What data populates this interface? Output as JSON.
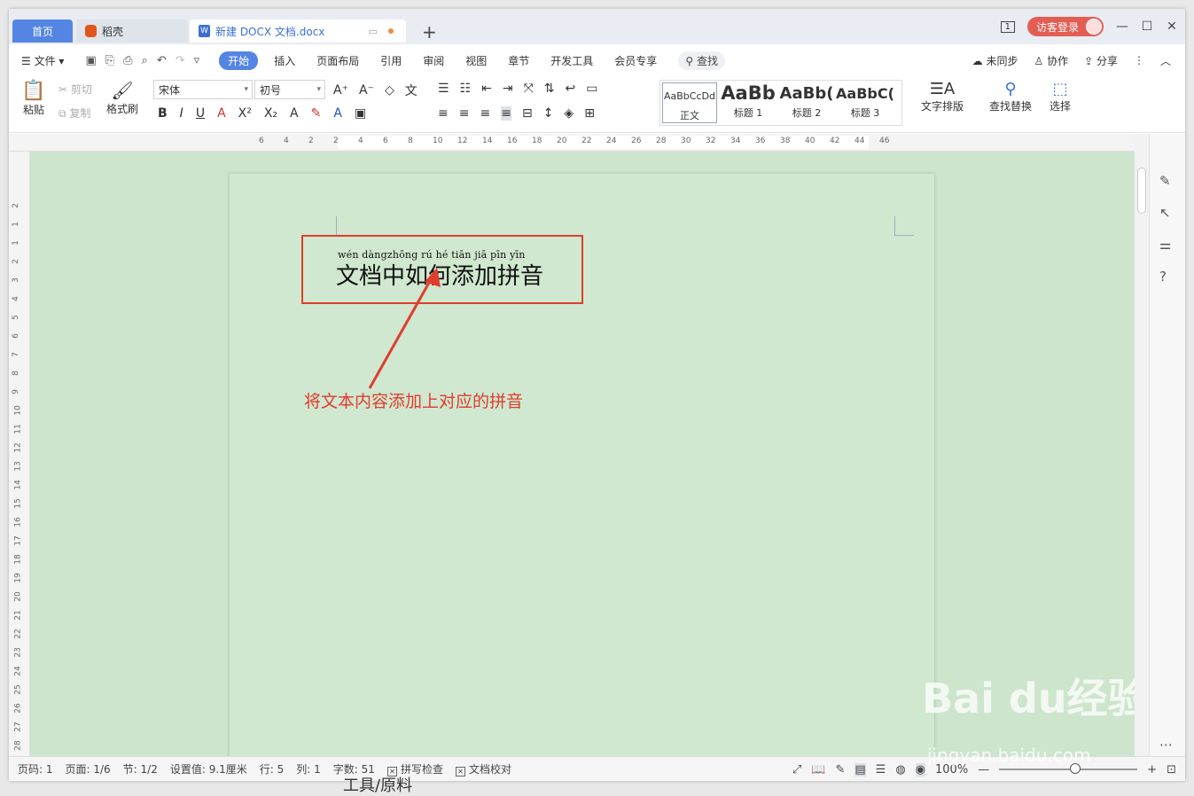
{
  "tabs": {
    "home": "首页",
    "daoke": "稻壳",
    "doc": "新建 DOCX 文档.docx",
    "new_tab": "+"
  },
  "titlebar": {
    "login": "访客登录",
    "minimize": "—",
    "maximize": "☐",
    "close": "✕",
    "window_count": "1"
  },
  "menu": {
    "file": "文件",
    "items": [
      "开始",
      "插入",
      "页面布局",
      "引用",
      "审阅",
      "视图",
      "章节",
      "开发工具",
      "会员专享"
    ],
    "search": "查找",
    "sync": "未同步",
    "collab": "协作",
    "share": "分享"
  },
  "ribbon": {
    "paste": "粘贴",
    "cut": "剪切",
    "copy": "复制",
    "format_painter": "格式刷",
    "font_name": "宋体",
    "font_size": "初号",
    "styles": [
      {
        "preview": "AaBbCcDd",
        "label": "正文"
      },
      {
        "preview": "AaBb",
        "label": "标题 1"
      },
      {
        "preview": "AaBb(",
        "label": "标题 2"
      },
      {
        "preview": "AaBbC(",
        "label": "标题 3"
      }
    ],
    "text_layout": "文字排版",
    "find_replace": "查找替换",
    "select": "选择"
  },
  "ruler": {
    "h_numbers": [
      "6",
      "4",
      "2",
      "2",
      "4",
      "6",
      "8",
      "10",
      "12",
      "14",
      "16",
      "18",
      "20",
      "22",
      "24",
      "26",
      "28",
      "30",
      "32",
      "34",
      "36",
      "38",
      "40",
      "42",
      "44",
      "46"
    ],
    "v_numbers": [
      "2",
      "1",
      "1",
      "2",
      "3",
      "4",
      "5",
      "6",
      "7",
      "8",
      "9",
      "10",
      "11",
      "12",
      "13",
      "14",
      "15",
      "16",
      "17",
      "18",
      "19",
      "20",
      "21",
      "22",
      "23",
      "24",
      "25",
      "26",
      "27",
      "28"
    ]
  },
  "document": {
    "pinyin": "wén dàngzhōng rú  hé tiān jiā pīn yīn",
    "text": "文档中如何添加拼音",
    "annotation": "将文本内容添加上对应的拼音"
  },
  "status": {
    "page_code": "页码: 1",
    "page": "页面: 1/6",
    "section": "节: 1/2",
    "setting": "设置值: 9.1厘米",
    "row": "行: 5",
    "col": "列: 1",
    "word_count": "字数: 51",
    "spell_check": "拼写检查",
    "doc_proof": "文档校对",
    "zoom": "100%"
  },
  "watermark": {
    "main": "Bai du经验",
    "sub": "jingyan.baidu.com"
  },
  "peek_text": "工具/原料",
  "colors": {
    "accent": "#5585e3",
    "annotation_red": "#e03c2f",
    "page_bg": "#cfe8cf"
  }
}
